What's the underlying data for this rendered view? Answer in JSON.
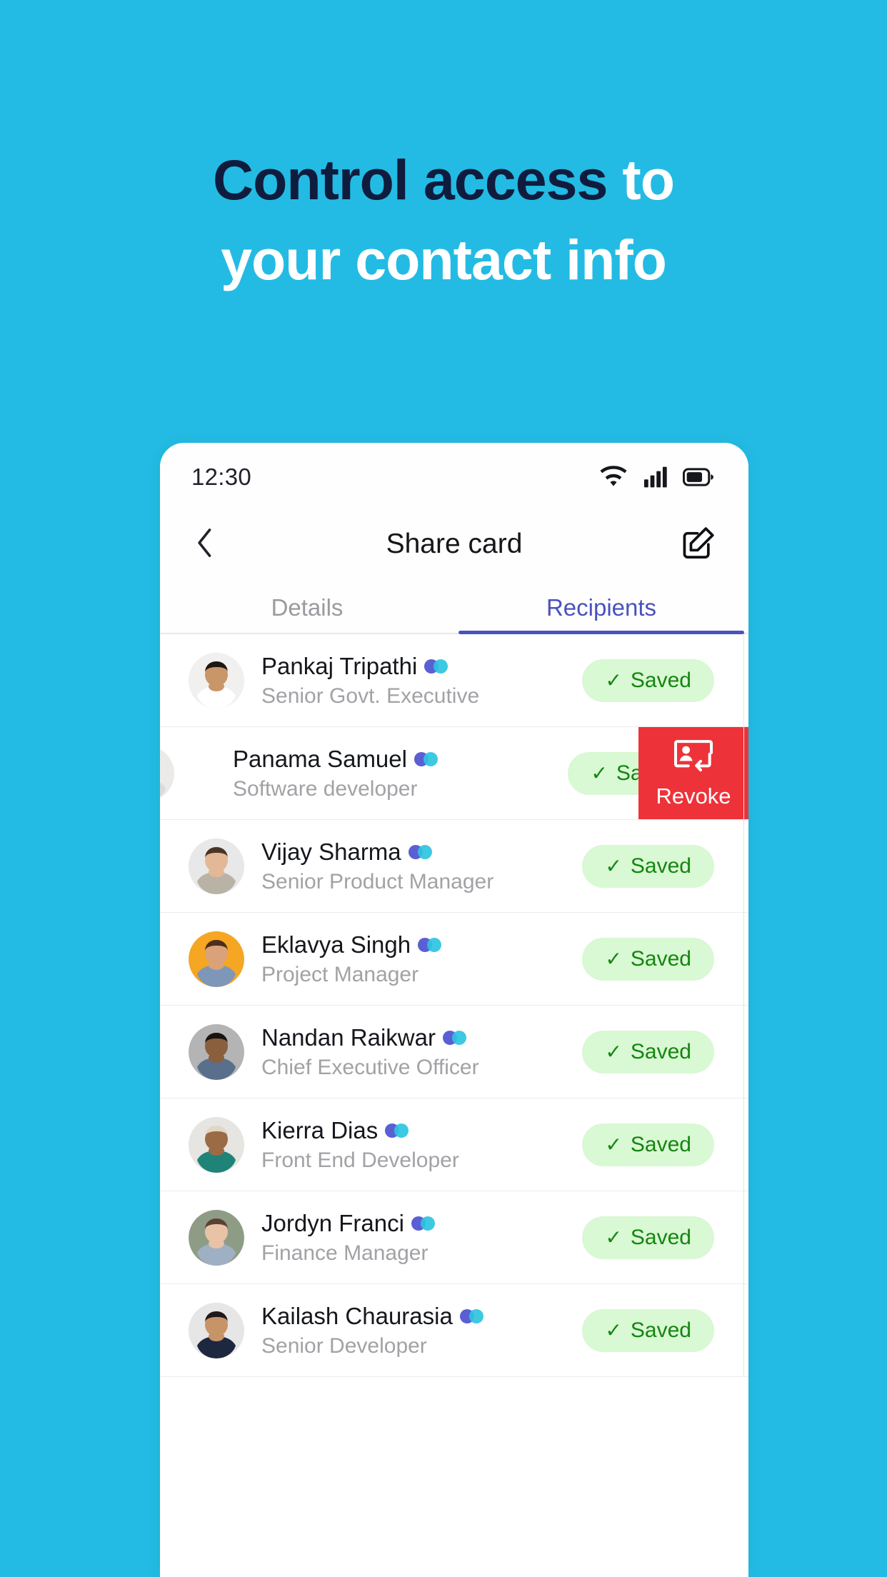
{
  "headline": {
    "line1_dark": "Control access",
    "line1_light": " to",
    "line2_light": "your contact info"
  },
  "colors": {
    "background": "#23bbe3",
    "headline_dark": "#101c3e",
    "headline_light": "#ffffff",
    "tab_active": "#4a52bd",
    "saved_bg": "#d9f8d4",
    "saved_text": "#15860f",
    "revoke_bg": "#ee3239",
    "dot_primary": "#5b5fd4",
    "dot_secondary": "#2ec4e0"
  },
  "phone": {
    "statusbar": {
      "time": "12:30",
      "icons": [
        "wifi-icon",
        "signal-icon",
        "battery-icon"
      ]
    },
    "appbar": {
      "back_icon": "chevron-left-icon",
      "title": "Share card",
      "edit_icon": "edit-pencil-icon"
    },
    "tabs": [
      {
        "label": "Details",
        "active": false
      },
      {
        "label": "Recipients",
        "active": true
      }
    ],
    "saved_label": "Saved",
    "saved_check": "✓",
    "revoke": {
      "label": "Revoke",
      "icon": "revoke-contact-icon"
    },
    "recipients": [
      {
        "name": "Pankaj Tripathi",
        "role": "Senior Govt. Executive",
        "status": "Saved",
        "swiped": false,
        "avatar_skin": "#c9966a",
        "avatar_bg": "#f1f0ee",
        "avatar_hair": "#1d1713",
        "avatar_shirt": "#ffffff"
      },
      {
        "name": "Panama Samuel",
        "role": "Software developer",
        "status": "Saved",
        "swiped": true,
        "avatar_skin": "#b88a62",
        "avatar_bg": "#eceae8",
        "avatar_hair": "#2a211b",
        "avatar_shirt": "#dadada"
      },
      {
        "name": "Vijay Sharma",
        "role": "Senior Product Manager",
        "status": "Saved",
        "swiped": false,
        "avatar_skin": "#e3b896",
        "avatar_bg": "#e8e8e8",
        "avatar_hair": "#4a3525",
        "avatar_shirt": "#b9b3a6"
      },
      {
        "name": "Eklavya Singh",
        "role": "Project Manager",
        "status": "Saved",
        "swiped": false,
        "avatar_skin": "#d9a279",
        "avatar_bg": "#f5a623",
        "avatar_hair": "#4b2f1c",
        "avatar_shirt": "#7e96b8"
      },
      {
        "name": "Nandan Raikwar",
        "role": "Chief Executive Officer",
        "status": "Saved",
        "swiped": false,
        "avatar_skin": "#8a5f3d",
        "avatar_bg": "#b4b4b4",
        "avatar_hair": "#171412",
        "avatar_shirt": "#5a6f8c"
      },
      {
        "name": "Kierra Dias",
        "role": "Front End Developer",
        "status": "Saved",
        "swiped": false,
        "avatar_skin": "#9a6b45",
        "avatar_bg": "#e7e5e1",
        "avatar_hair": "#e0d7c7",
        "avatar_shirt": "#1f8378"
      },
      {
        "name": "Jordyn Franci",
        "role": "Finance Manager",
        "status": "Saved",
        "swiped": false,
        "avatar_skin": "#e8c3a5",
        "avatar_bg": "#8e9c86",
        "avatar_hair": "#5a4232",
        "avatar_shirt": "#9fb0c4"
      },
      {
        "name": "Kailash Chaurasia",
        "role": "Senior Developer",
        "status": "Saved",
        "swiped": false,
        "avatar_skin": "#c79468",
        "avatar_bg": "#e6e6e6",
        "avatar_hair": "#20191a",
        "avatar_shirt": "#1e2740"
      }
    ]
  }
}
